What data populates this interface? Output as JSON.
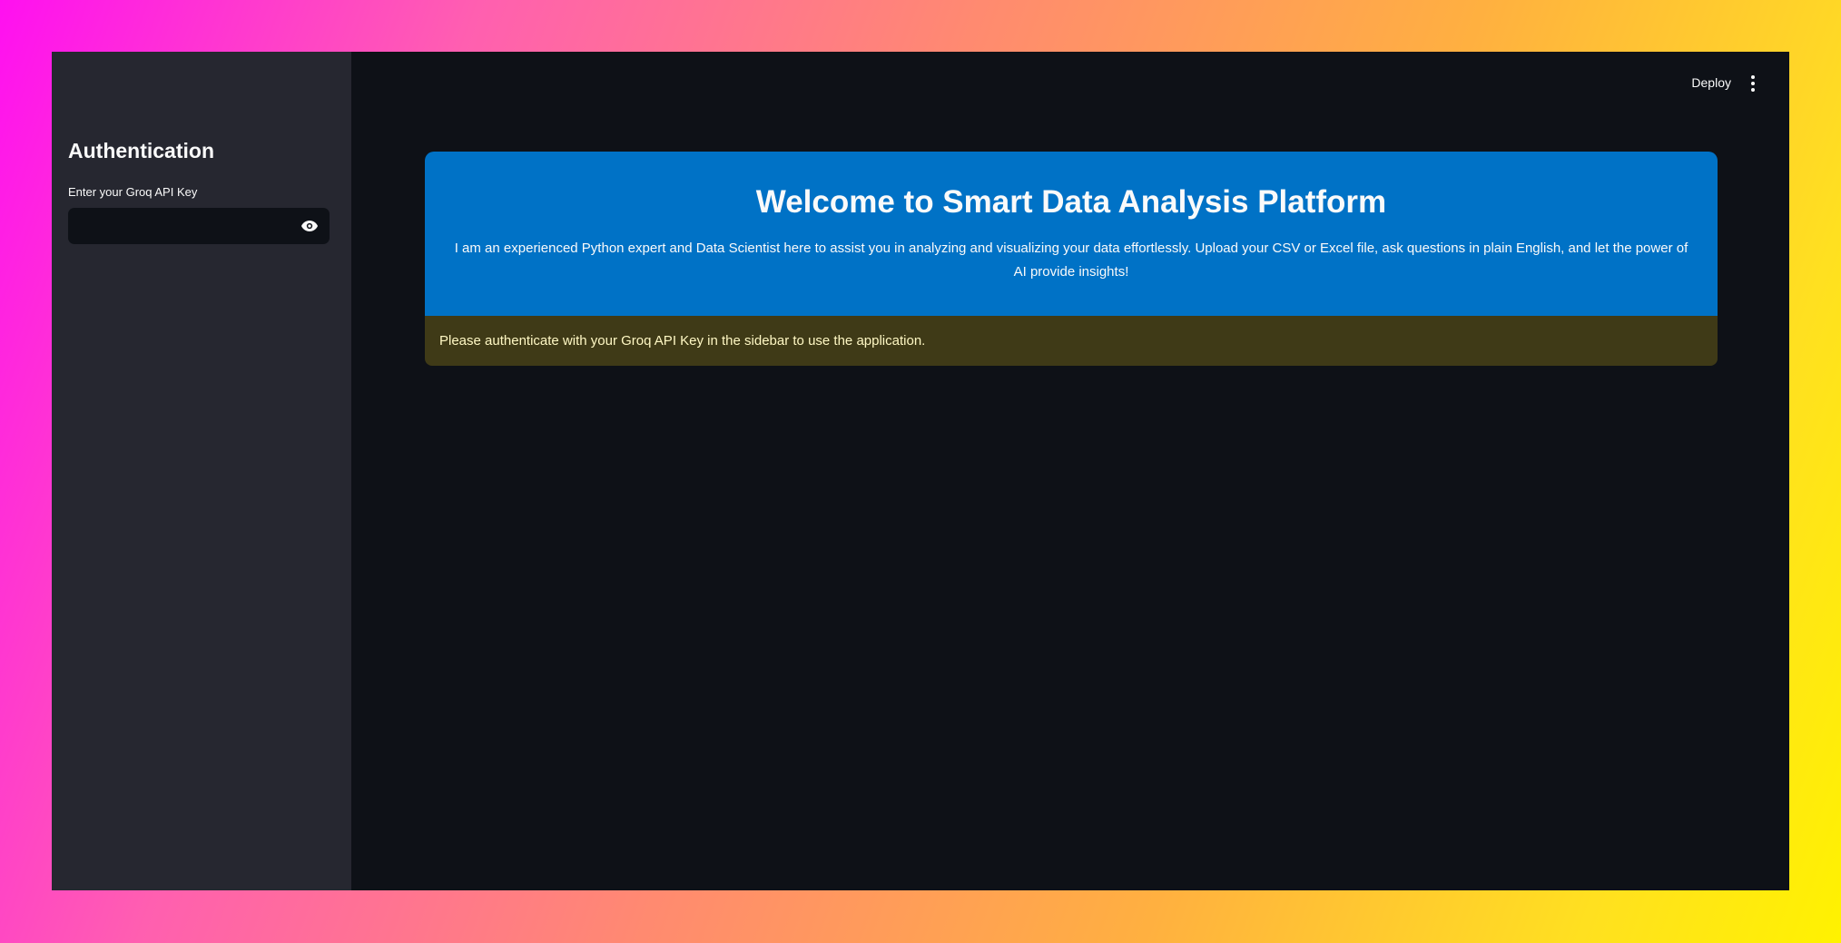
{
  "sidebar": {
    "title": "Authentication",
    "api_key_label": "Enter your Groq API Key",
    "api_key_value": "",
    "reveal_icon": "eye-icon"
  },
  "header": {
    "deploy_label": "Deploy",
    "menu_icon": "vertical-ellipsis-icon"
  },
  "hero": {
    "title": "Welcome to Smart Data Analysis Platform",
    "text": "I am an experienced Python expert and Data Scientist here to assist you in analyzing and visualizing your data effortlessly. Upload your CSV or Excel file, ask questions in plain English, and let the power of AI provide insights!"
  },
  "warning": {
    "text": "Please authenticate with your Groq API Key in the sidebar to use the application."
  },
  "colors": {
    "sidebar_bg": "#262730",
    "main_bg": "#0e1117",
    "hero_bg": "#0072c6",
    "warning_bg": "#3f3a17",
    "warning_text": "#fff8c4"
  }
}
